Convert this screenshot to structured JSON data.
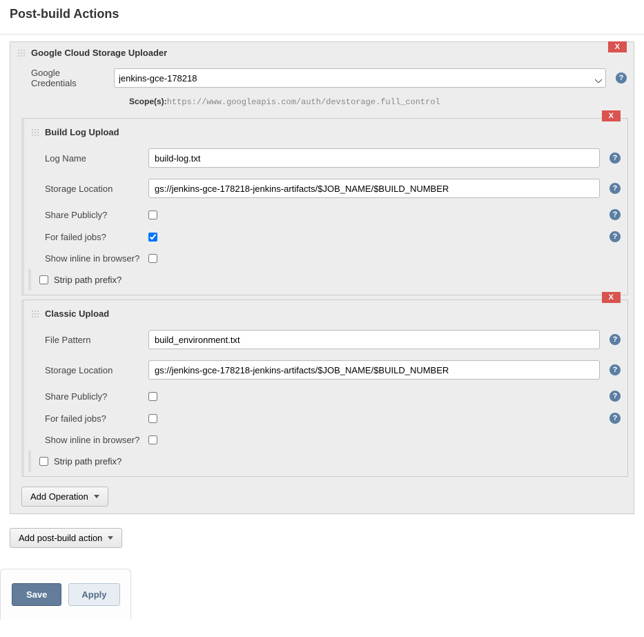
{
  "page": {
    "title": "Post-build Actions"
  },
  "uploader": {
    "title": "Google Cloud Storage Uploader",
    "delete_label": "X",
    "credentials_label": "Google Credentials",
    "credentials_value": "jenkins-gce-178218",
    "scope_label": "Scope(s):",
    "scope_value": "https://www.googleapis.com/auth/devstorage.full_control"
  },
  "build_log_upload": {
    "title": "Build Log Upload",
    "delete_label": "X",
    "fields": {
      "log_name_label": "Log Name",
      "log_name_value": "build-log.txt",
      "storage_label": "Storage Location",
      "storage_value": "gs://jenkins-gce-178218-jenkins-artifacts/$JOB_NAME/$BUILD_NUMBER",
      "share_label": "Share Publicly?",
      "failed_label": "For failed jobs?",
      "inline_label": "Show inline in browser?",
      "strip_label": "Strip path prefix?"
    },
    "share_publicly": false,
    "for_failed": true,
    "show_inline": false,
    "strip_prefix": false
  },
  "classic_upload": {
    "title": "Classic Upload",
    "delete_label": "X",
    "fields": {
      "pattern_label": "File Pattern",
      "pattern_value": "build_environment.txt",
      "storage_label": "Storage Location",
      "storage_value": "gs://jenkins-gce-178218-jenkins-artifacts/$JOB_NAME/$BUILD_NUMBER",
      "share_label": "Share Publicly?",
      "failed_label": "For failed jobs?",
      "inline_label": "Show inline in browser?",
      "strip_label": "Strip path prefix?"
    },
    "share_publicly": false,
    "for_failed": false,
    "show_inline": false,
    "strip_prefix": false
  },
  "buttons": {
    "add_operation": "Add Operation",
    "add_post_build": "Add post-build action",
    "save": "Save",
    "apply": "Apply"
  },
  "help_icon": "?"
}
